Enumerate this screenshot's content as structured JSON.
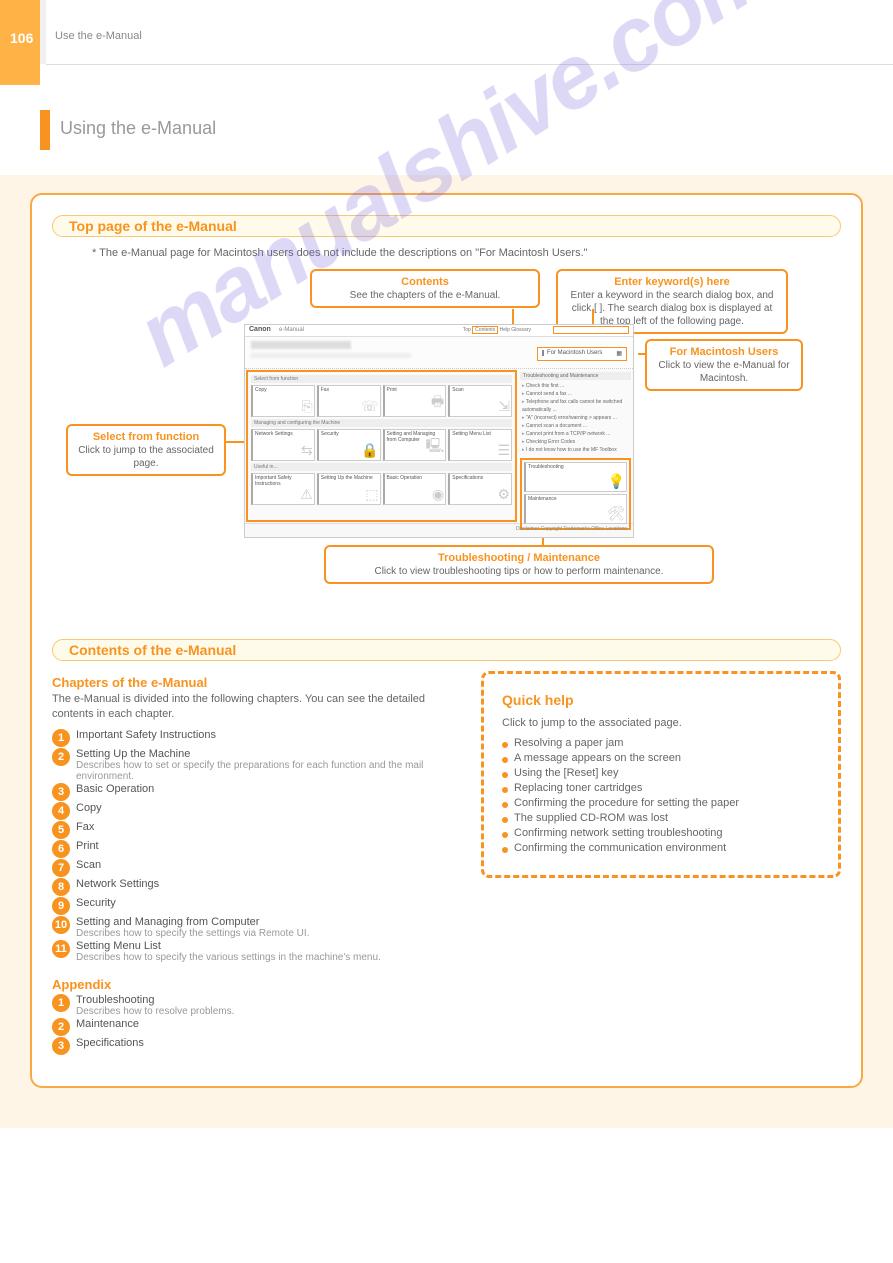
{
  "page": {
    "number": "106",
    "headerText": "Use the e-Manual",
    "title": "Using the e-Manual"
  },
  "section1": {
    "title": "Top page of the e-Manual",
    "intro": "*  The e-Manual page for Macintosh users does not include the descriptions on \"For Macintosh Users.\""
  },
  "callouts": {
    "feature": {
      "title": "Select from function",
      "desc": "Click to jump to the associated page."
    },
    "trouble": {
      "title": "Troubleshooting / Maintenance",
      "desc": "Click to view troubleshooting tips or how to perform maintenance."
    },
    "contents": {
      "title": "Contents",
      "desc": "See the chapters of the e-Manual."
    },
    "search": {
      "title": "Enter keyword(s) here",
      "desc": "Enter a keyword in the search dialog box, and click [    ]. The search dialog box is displayed at the top left of the following page."
    },
    "mac": {
      "title": "For Macintosh Users",
      "desc": "Click to view the e-Manual for Macintosh."
    }
  },
  "screenshot": {
    "brand": "Canon",
    "emanual": "e-Manual",
    "topLinks": {
      "top": "Top",
      "contents": "Contents",
      "help": "Help",
      "glossary": "Glossary"
    },
    "macintoshBtn": "For Macintosh Users",
    "groups": {
      "g1": "Select from function",
      "g2": "Managing and configuring the Machine",
      "g3": "Useful in...",
      "right1": "Troubleshooting and Maintenance"
    },
    "tiles": {
      "copy": "Copy",
      "fax": "Fax",
      "print": "Print",
      "scan": "Scan",
      "network": "Network Settings",
      "security": "Security",
      "setfrom": "Setting and Managing from Computer",
      "menulist": "Setting Menu List",
      "safety": "Important Safety Instructions",
      "setup": "Setting Up the Machine",
      "basic": "Basic Operation",
      "spec": "Specifications",
      "troubleshoot": "Troubleshooting",
      "maintenance": "Maintenance"
    },
    "rightLinks": [
      "Check this first ...",
      "Cannot send a fax ...",
      "Telephone and fax calls cannot be switched automatically ...",
      "\"A\" (incorrect) error/warning > appears ...",
      "Cannot scan a document ...",
      "Cannot print from a TCP/IP network ...",
      "Checking Error Codes",
      "I do not know how to use the MF Toolbox"
    ],
    "footer": "Disclaimer    Copyright    Trademarks    Office Locations"
  },
  "section2": {
    "title": "Contents of the e-Manual"
  },
  "chapters": {
    "subhead": "Chapters of the e-Manual",
    "desc": "The e-Manual is divided into the following chapters. You can see the detailed contents in each chapter.",
    "list": [
      {
        "n": "1",
        "label": "Important Safety Instructions",
        "sub": ""
      },
      {
        "n": "2",
        "label": "Setting Up the Machine",
        "sub": "Describes how to set or specify the preparations for each function and the mail environment."
      },
      {
        "n": "3",
        "label": "Basic Operation",
        "sub": ""
      },
      {
        "n": "4",
        "label": "Copy",
        "sub": ""
      },
      {
        "n": "5",
        "label": "Fax",
        "sub": ""
      },
      {
        "n": "6",
        "label": "Print",
        "sub": ""
      },
      {
        "n": "7",
        "label": "Scan",
        "sub": ""
      },
      {
        "n": "8",
        "label": "Network Settings",
        "sub": ""
      },
      {
        "n": "9",
        "label": "Security",
        "sub": ""
      },
      {
        "n": "10",
        "label": "Setting and Managing from Computer",
        "sub": "Describes how to specify the settings via Remote UI."
      },
      {
        "n": "11",
        "label": "Setting Menu List",
        "sub": "Describes how to specify the various settings in the machine's menu."
      }
    ],
    "appendix": "Appendix",
    "appendixList": [
      {
        "n": "1",
        "label": "Troubleshooting",
        "sub": "Describes how to resolve problems."
      },
      {
        "n": "2",
        "label": "Maintenance",
        "sub": ""
      },
      {
        "n": "3",
        "label": "Specifications",
        "sub": ""
      }
    ]
  },
  "quickhelp": {
    "title": "Quick help",
    "intro": "Click to jump to the associated page.",
    "items": [
      "Resolving a paper jam",
      "A message appears on the screen",
      "Using the [Reset] key",
      "Replacing toner cartridges",
      "Confirming the procedure for setting the paper",
      "The supplied CD-ROM was lost",
      "Confirming network setting troubleshooting",
      "Confirming the communication environment"
    ]
  },
  "watermark": "manualshive.com"
}
